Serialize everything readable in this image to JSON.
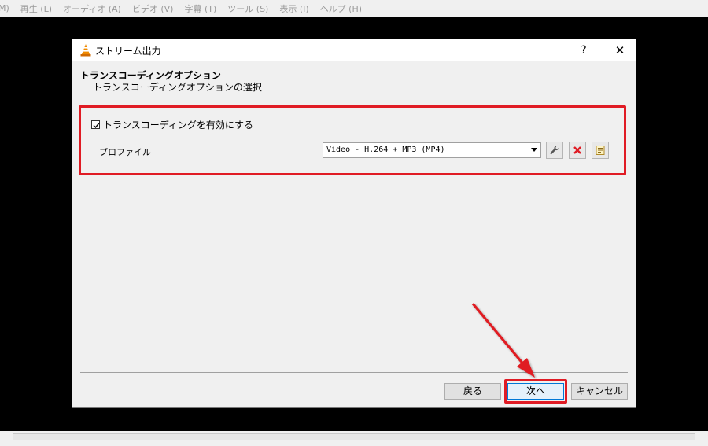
{
  "menu": {
    "items": [
      "M)",
      "再生 (L)",
      "オーディオ (A)",
      "ビデオ (V)",
      "字幕 (T)",
      "ツール (S)",
      "表示 (I)",
      "ヘルプ (H)"
    ]
  },
  "dialog": {
    "title": "ストリーム出力",
    "help_label": "?",
    "close_label": "✕",
    "header": {
      "title": "トランスコーディングオプション",
      "subtitle": "トランスコーディングオプションの選択"
    },
    "transcode": {
      "checkbox_label": "トランスコーディングを有効にする",
      "checked": true
    },
    "profile": {
      "label": "プロファイル",
      "selected": "Video - H.264 + MP3 (MP4)"
    },
    "buttons": {
      "back": "戻る",
      "next": "次へ",
      "cancel": "キャンセル"
    }
  },
  "icons": {
    "title": "vlc-cone-icon",
    "edit_profile": "wrench-icon",
    "delete_profile": "red-x-icon",
    "new_profile": "new-profile-icon"
  },
  "colors": {
    "highlight": "#e01b24",
    "dialog_bg": "#f0f0f0",
    "next_border": "#0078d7"
  }
}
